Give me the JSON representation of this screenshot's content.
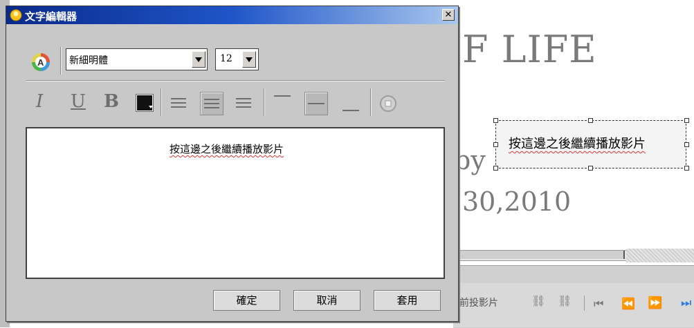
{
  "dialog": {
    "title": "文字編輯器",
    "font_name": "新細明體",
    "font_size": "12",
    "format_buttons": {
      "italic": "I",
      "underline": "U",
      "bold": "B"
    },
    "text_content": "按這邊之後繼續播放影片",
    "buttons": {
      "ok": "確定",
      "cancel": "取消",
      "apply": "套用"
    },
    "close_label": "✕",
    "color_swatch": "#111111"
  },
  "slide": {
    "title": "F LIFE",
    "by_line": "by",
    "date": "30,2010",
    "selected_text": "按這邊之後繼續播放影片"
  },
  "bottom_toolbar": {
    "label": "前投影片"
  },
  "colors": {
    "titlebar_start": "#0a2a8a",
    "titlebar_end": "#a9c7ee",
    "accent_blue": "#2f7fd8"
  }
}
